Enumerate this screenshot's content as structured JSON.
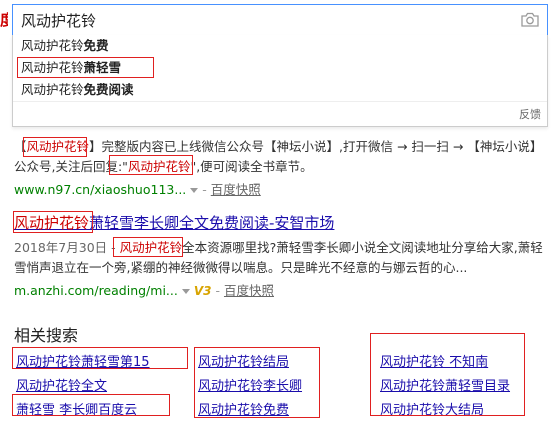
{
  "search": {
    "query": "风动护花铃"
  },
  "suggestions": [
    {
      "prefix": "风动护花铃",
      "suffix": "免费"
    },
    {
      "prefix": "风动护花铃",
      "suffix": "萧轻雪"
    },
    {
      "prefix": "风动护花铃",
      "suffix": "免费阅读"
    }
  ],
  "dropdown": {
    "feedback": "反馈"
  },
  "results": [
    {
      "body_parts": [
        "【",
        "风动护花铃",
        "】完整版内容已上线微信公众号【神坛小说】,打开微信 → 扫一扫 → 【神坛小说】公众号,关注后回复:\"",
        "风动护花铃",
        "\",便可阅读全书章节。"
      ],
      "url": "www.n97.cn/xiaoshuo113...",
      "snapshot": "百度快照"
    },
    {
      "title_highlight": "风动护花铃",
      "title_rest": "萧轻雪李长卿全文免费阅读-安智市场",
      "date": "2018年7月30日 - ",
      "body_highlight": "风动护花铃",
      "body_rest": "全本资源哪里找?萧轻雪李长卿小说全文阅读地址分享给大家,萧轻雪悄声退立在一个旁,紧绷的神经微微得以喘息。只是眸光不经意的与娜云哲的心...",
      "url": "m.anzhi.com/reading/mi...",
      "badge": "V3",
      "snapshot": "百度快照"
    }
  ],
  "related": {
    "heading": "相关搜索",
    "col1": [
      "风动护花铃萧轻雪第15",
      "风动护花铃全文",
      "萧轻雪 李长卿百度云"
    ],
    "col2": [
      "风动护花铃结局",
      "风动护花铃李长卿",
      "风动护花铃免费"
    ],
    "col3": [
      "风动护花铃 不知南",
      "风动护花铃萧轻雪目录",
      "风动护花铃大结局"
    ]
  }
}
